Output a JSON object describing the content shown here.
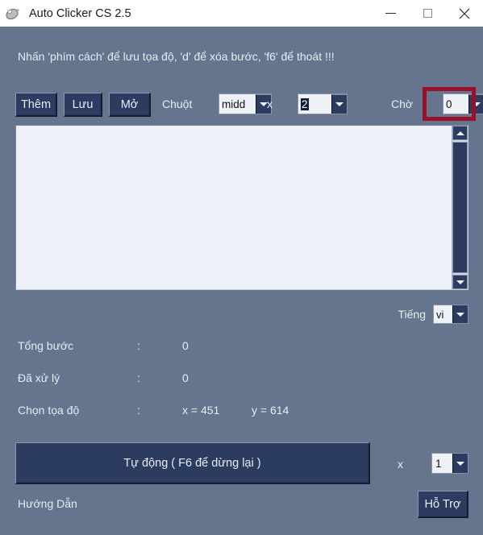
{
  "window": {
    "title": "Auto Clicker CS 2.5",
    "icon": "mouse-icon",
    "background_color": "#64758d",
    "titlebar_color": "#ffffff",
    "accent_button_color": "#2c3c60",
    "highlight_color": "#9a1028",
    "controls": {
      "minimize": "minimize-icon",
      "maximize": "maximize-icon",
      "close": "close-icon"
    }
  },
  "hint": {
    "text": "Nhấn 'phím cách' để lưu tọa độ, 'd' để xóa bước, 'f6' để thoát !!!"
  },
  "toolbar": {
    "add_label": "Thêm",
    "save_label": "Lưu",
    "open_label": "Mở",
    "mouse_label": "Chuột",
    "mouse_value": "midd",
    "times_label": "x",
    "click_count_value": "2",
    "wait_label": "Chờ",
    "wait_value": "0"
  },
  "steps_area": {
    "content": "",
    "scroll_up": "scroll-up-arrow",
    "scroll_down": "scroll-down-arrow"
  },
  "language": {
    "label": "Tiếng",
    "value": "vi"
  },
  "stats": {
    "rows": [
      {
        "label": "Tổng bước",
        "separator": ":",
        "value": "0",
        "value2": ""
      },
      {
        "label": "Đã xử lý",
        "separator": ":",
        "value": "0",
        "value2": ""
      },
      {
        "label": "Chọn tọa độ",
        "separator": ":",
        "value": "x = 451",
        "value2": "y = 614"
      }
    ]
  },
  "footer": {
    "auto_button_label": "Tự động ( F6 để dừng lại )",
    "repeat_times_label": "x",
    "repeat_value": "1",
    "guide_label": "Hướng Dẫn",
    "support_label": "Hỗ Trợ"
  }
}
